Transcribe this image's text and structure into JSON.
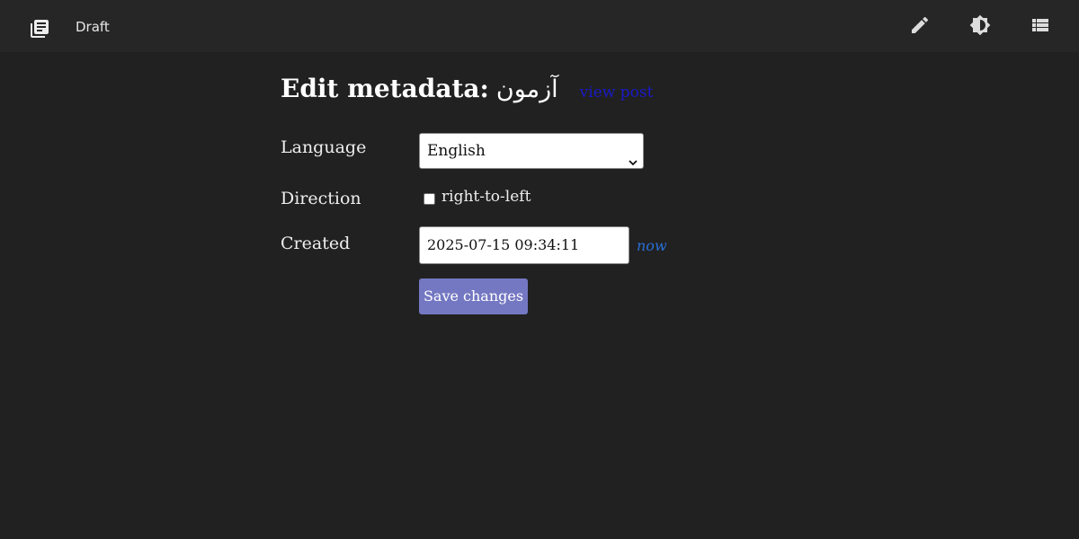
{
  "topbar": {
    "app_label": "Draft",
    "logo_icon": "library-books-icon",
    "icons": [
      "edit-pencil-icon",
      "theme-brightness-icon",
      "list-view-icon"
    ]
  },
  "main": {
    "title_prefix": "Edit metadata:",
    "post_name": "آزمون",
    "view_post_label": "view post",
    "language_label": "Language",
    "language_value": "English",
    "direction_label": "Direction",
    "rtl_checkbox_label": "right-to-left",
    "rtl_checked": false,
    "created_label": "Created",
    "created_value": "2025-07-15 09:34:11",
    "now_label": "now",
    "save_label": "Save changes"
  },
  "colors": {
    "background": "#212121",
    "topbar": "#262626",
    "link": "#1a1ac8",
    "now_link": "#2a6fd6",
    "save_button": "#7478c2"
  }
}
